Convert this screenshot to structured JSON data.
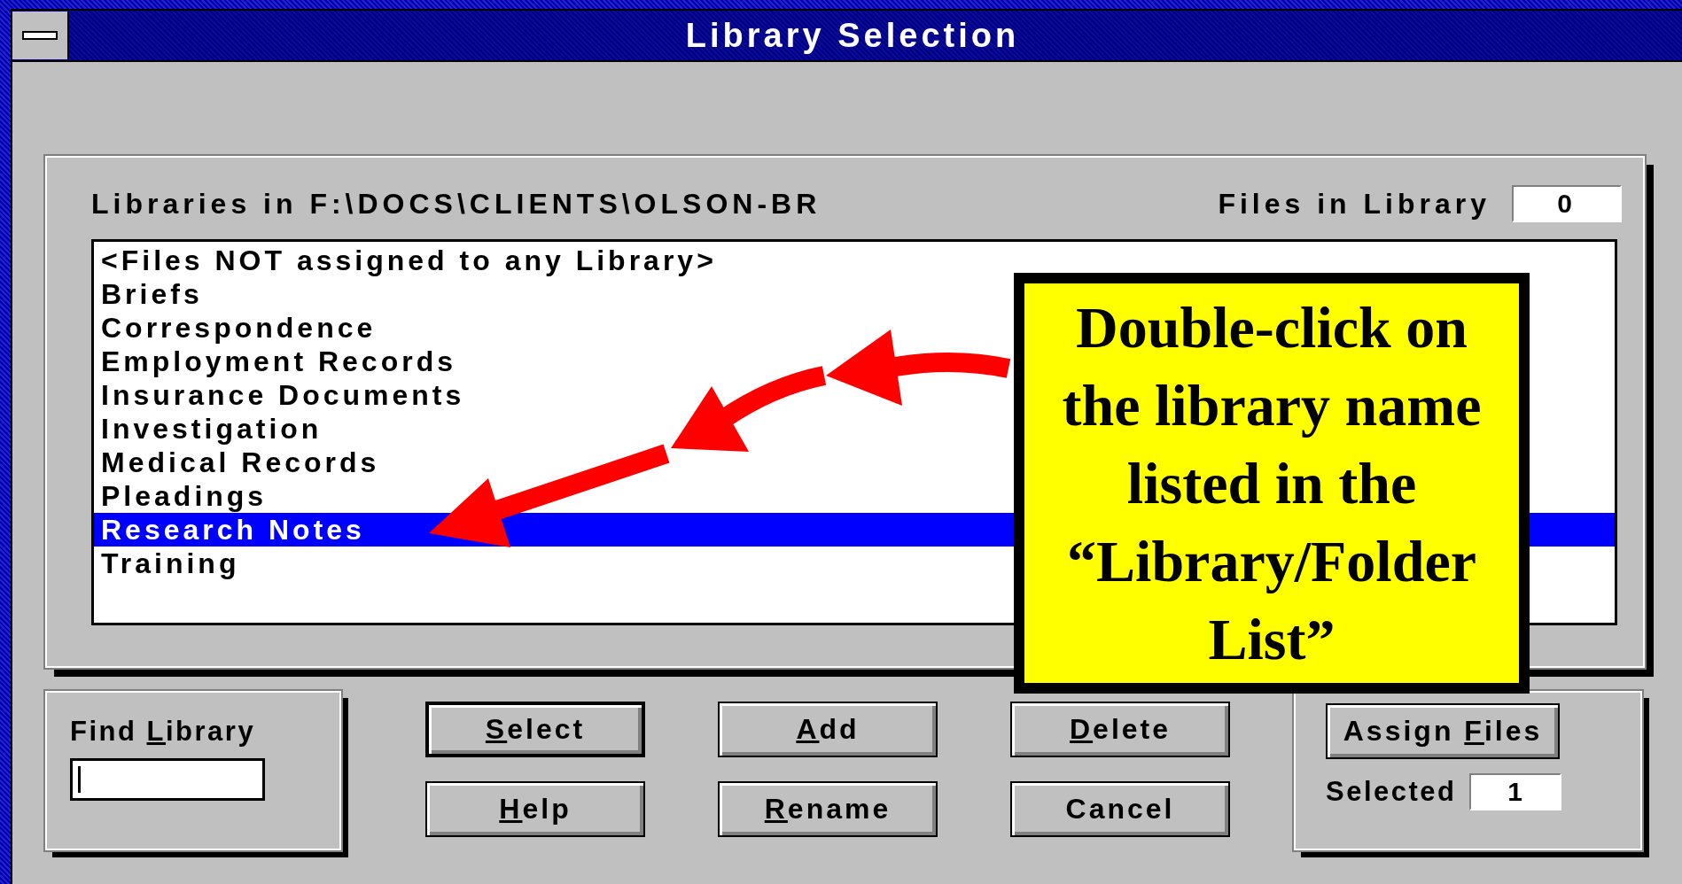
{
  "window": {
    "title": "Library Selection"
  },
  "libraries": {
    "header": "Libraries in F:\\DOCS\\CLIENTS\\OLSON-BR",
    "files_label": "Files in Library",
    "files_count": "0",
    "items": [
      {
        "label": "<Files NOT assigned to any Library>",
        "selected": false
      },
      {
        "label": "Briefs",
        "selected": false
      },
      {
        "label": "Correspondence",
        "selected": false
      },
      {
        "label": "Employment Records",
        "selected": false
      },
      {
        "label": "Insurance Documents",
        "selected": false
      },
      {
        "label": "Investigation",
        "selected": false
      },
      {
        "label": "Medical Records",
        "selected": false
      },
      {
        "label": "Pleadings",
        "selected": false
      },
      {
        "label": "Research Notes",
        "selected": true
      },
      {
        "label": "Training",
        "selected": false
      }
    ]
  },
  "callout": {
    "text": "Double-click on the library name listed in the “Library/Folder List”"
  },
  "find": {
    "label": {
      "before": "Find ",
      "key": "L",
      "after": "ibrary"
    },
    "focused": true
  },
  "buttons": [
    {
      "label": {
        "key": "S",
        "after": "elect"
      },
      "default": true
    },
    {
      "label": {
        "key": "A",
        "after": "dd"
      },
      "default": false
    },
    {
      "label": {
        "key": "D",
        "after": "elete"
      },
      "default": false
    },
    {
      "label": {
        "key": "H",
        "after": "elp"
      },
      "default": false
    },
    {
      "label": {
        "key": "R",
        "after": "ename"
      },
      "default": false
    },
    {
      "label": {
        "before": "Cancel"
      },
      "default": false
    }
  ],
  "assign": {
    "label": {
      "before": "Assign ",
      "key": "F",
      "after": "iles"
    },
    "selected_label": "Selected",
    "selected_count": "1"
  }
}
